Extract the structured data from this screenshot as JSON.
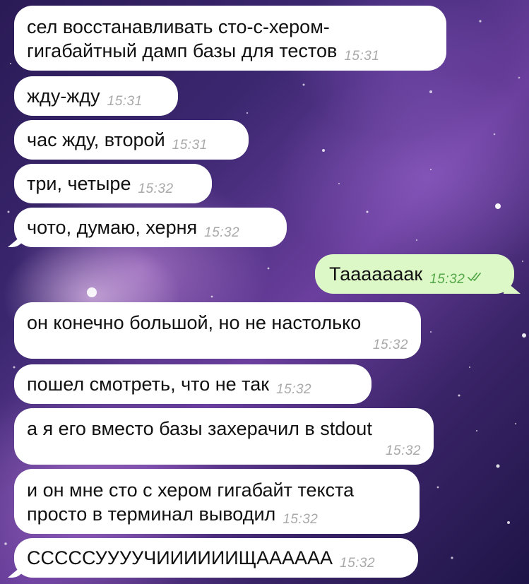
{
  "messages": [
    {
      "text": "сел восстанавливать сто-с-хером-\nгигабайтный дамп базы для тестов",
      "time": "15:31"
    },
    {
      "text": "жду-жду",
      "time": "15:31"
    },
    {
      "text": "час жду, второй",
      "time": "15:31"
    },
    {
      "text": "три, четыре",
      "time": "15:32"
    },
    {
      "text": "чото, думаю, херня",
      "time": "15:32"
    },
    {
      "text": "Тааааааак",
      "time": "15:32",
      "outgoing": true,
      "status_icon": "double-check-icon"
    },
    {
      "text": "он конечно большой, но не настолько",
      "time": "15:32"
    },
    {
      "text": "пошел смотреть, что не так",
      "time": "15:32"
    },
    {
      "text": "а я его вместо базы захерачил в stdout",
      "time": "15:32"
    },
    {
      "text": "и он мне сто с хером гигабайт текста\nпросто в терминал выводил",
      "time": "15:32"
    },
    {
      "text": "СССССУУУУЧИИИИИИЩАААААА",
      "time": "15:32"
    }
  ],
  "colors": {
    "incoming_bubble": "#ffffff",
    "outgoing_bubble": "#dcf8c6",
    "outgoing_time": "#55a84a",
    "incoming_time": "#a9a9a9"
  }
}
